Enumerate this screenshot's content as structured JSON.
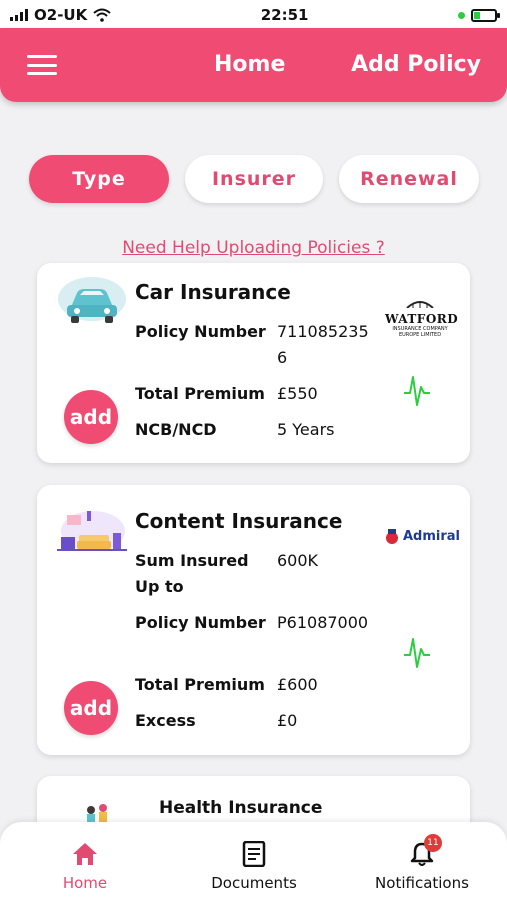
{
  "status_bar": {
    "carrier": "O2-UK",
    "time": "22:51",
    "battery_level": 0.25
  },
  "header": {
    "menu_icon": "hamburger-menu-icon",
    "home_label": "Home",
    "add_policy_label": "Add Policy"
  },
  "filters": {
    "items": [
      "Type",
      "Insurer",
      "Renewal"
    ],
    "selected": "Type"
  },
  "help_link": "Need Help Uploading Policies ?",
  "policies": [
    {
      "title": "Car Insurance",
      "illustration": "car-icon",
      "insurer_logo": {
        "name": "WATFORD",
        "sub": "INSURANCE COMPANY EUROPE LIMITED"
      },
      "rows": [
        {
          "label": "Policy Number",
          "value": "7110852356"
        },
        {
          "label": "Total Premium",
          "value": "£550"
        },
        {
          "label": "NCB/NCD",
          "value": "5 Years"
        }
      ],
      "add_label": "add"
    },
    {
      "title": "Content Insurance",
      "illustration": "living-room-icon",
      "insurer_logo": {
        "name": "Admiral"
      },
      "rows": [
        {
          "label": "Sum Insured Up to",
          "value": "600K"
        },
        {
          "label": "Policy Number",
          "value": "P61087000"
        },
        {
          "label": "Total Premium",
          "value": "£600"
        },
        {
          "label": "Excess",
          "value": "£0"
        }
      ],
      "add_label": "add"
    },
    {
      "title": "Health Insurance",
      "illustration": "family-icon"
    }
  ],
  "bottom_nav": {
    "items": [
      {
        "label": "Home",
        "icon": "home-icon",
        "active": true
      },
      {
        "label": "Documents",
        "icon": "document-icon",
        "active": false
      },
      {
        "label": "Notifications",
        "icon": "bell-icon",
        "active": false,
        "badge": "11"
      }
    ]
  },
  "colors": {
    "primary": "#f04c73",
    "accent_text": "#e04b72",
    "pulse": "#2ecc40",
    "background": "#f1f1f3"
  }
}
